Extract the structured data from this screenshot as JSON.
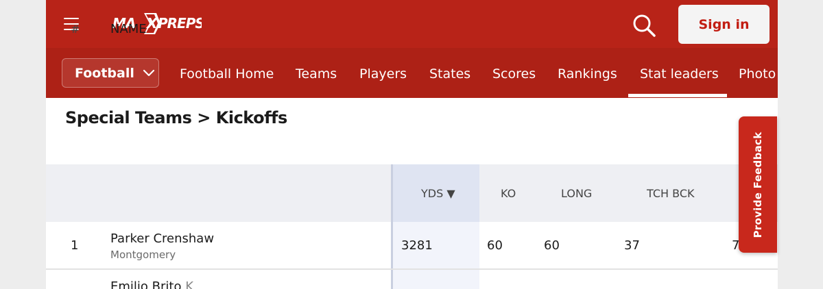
{
  "header": {
    "logo": "MAXPREPS",
    "signin_label": "Sign in"
  },
  "subnav": {
    "sport_select": "Football",
    "items": [
      "Football Home",
      "Teams",
      "Players",
      "States",
      "Scores",
      "Rankings",
      "Stat leaders",
      "Photo"
    ],
    "active": "Stat leaders"
  },
  "page": {
    "title": "Special Teams > Kickoffs"
  },
  "table": {
    "columns": [
      "#",
      "NAME",
      "YDS",
      "KO",
      "LONG",
      "TCH BCK"
    ],
    "sort_indicator": "▼",
    "rows": [
      {
        "rank": "1",
        "name": "Parker Crenshaw",
        "school": "Montgomery",
        "yds": "3281",
        "ko": "60",
        "long": "60",
        "tchbck": "37",
        "extra": "7"
      },
      {
        "rank": "",
        "name": "Emilio Brito",
        "position": "K",
        "school": "",
        "yds": "",
        "ko": "",
        "long": "",
        "tchbck": "",
        "extra": ""
      }
    ]
  },
  "feedback": {
    "label": "Provide Feedback"
  },
  "colors": {
    "brand_red": "#b82318",
    "subnav_red": "#ad2116",
    "signin_text": "#c21d12",
    "highlight_col": "#dfe4f2"
  }
}
